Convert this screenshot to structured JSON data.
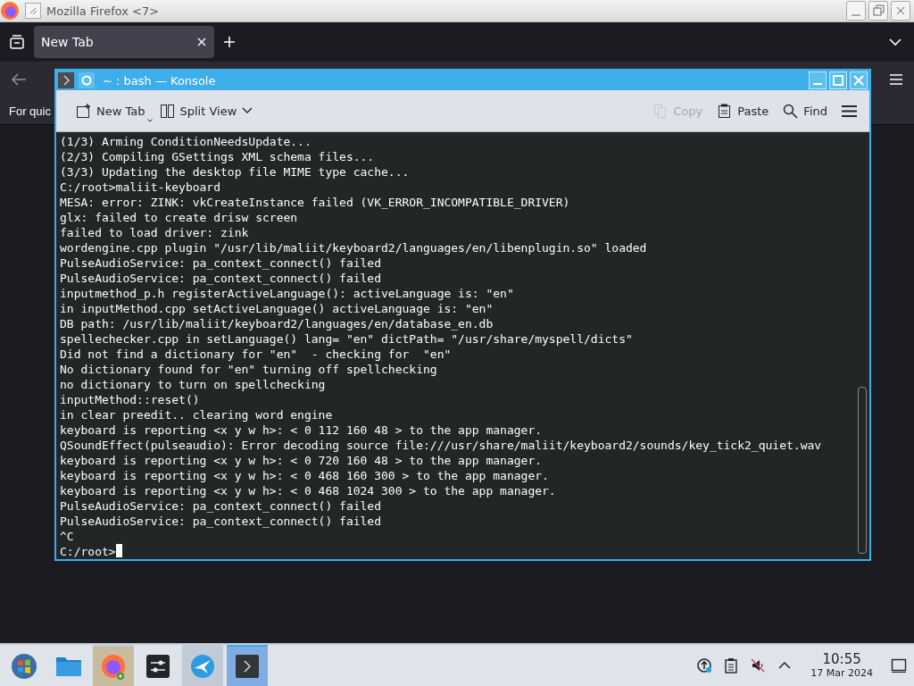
{
  "firefox": {
    "title": "Mozilla Firefox <7>",
    "tabs": [
      {
        "label": "New Tab",
        "selected": true
      }
    ],
    "bookmark_text": "For quic"
  },
  "konsole": {
    "title": "~ : bash — Konsole",
    "toolbar": [
      {
        "kind": "new-tab",
        "label": "New Tab",
        "disabled": false
      },
      {
        "kind": "split-view",
        "label": "Split View",
        "disabled": false
      },
      {
        "kind": "copy",
        "label": "Copy",
        "disabled": true
      },
      {
        "kind": "paste",
        "label": "Paste",
        "disabled": false
      },
      {
        "kind": "find",
        "label": "Find",
        "disabled": false
      },
      {
        "kind": "menu",
        "disabled": false
      }
    ],
    "lines": [
      "(1/3) Arming ConditionNeedsUpdate...",
      "(2/3) Compiling GSettings XML schema files...",
      "(3/3) Updating the desktop file MIME type cache...",
      "C:/root>maliit-keyboard",
      "MESA: error: ZINK: vkCreateInstance failed (VK_ERROR_INCOMPATIBLE_DRIVER)",
      "glx: failed to create drisw screen",
      "failed to load driver: zink",
      "wordengine.cpp plugin \"/usr/lib/maliit/keyboard2/languages/en/libenplugin.so\" loaded",
      "PulseAudioService: pa_context_connect() failed",
      "PulseAudioService: pa_context_connect() failed",
      "inputmethod_p.h registerActiveLanguage(): activeLanguage is: \"en\"",
      "in inputMethod.cpp setActiveLanguage() activeLanguage is: \"en\"",
      "DB path: /usr/lib/maliit/keyboard2/languages/en/database_en.db",
      "spellechecker.cpp in setLanguage() lang= \"en\" dictPath= \"/usr/share/myspell/dicts\"",
      "Did not find a dictionary for \"en\"  - checking for  \"en\"",
      "No dictionary found for \"en\" turning off spellchecking",
      "no dictionary to turn on spellchecking",
      "inputMethod::reset()",
      "in clear preedit.. clearing word engine",
      "keyboard is reporting <x y w h>: < 0 112 160 48 > to the app manager.",
      "QSoundEffect(pulseaudio): Error decoding source file:///usr/share/maliit/keyboard2/sounds/key_tick2_quiet.wav",
      "keyboard is reporting <x y w h>: < 0 720 160 48 > to the app manager.",
      "keyboard is reporting <x y w h>: < 0 468 160 300 > to the app manager.",
      "keyboard is reporting <x y w h>: < 0 468 1024 300 > to the app manager.",
      "PulseAudioService: pa_context_connect() failed",
      "PulseAudioService: pa_context_connect() failed",
      "^C",
      "C:/root>"
    ]
  },
  "taskbar": {
    "apps": [
      {
        "kind": "start",
        "selected": false,
        "attention": false,
        "open": false
      },
      {
        "kind": "files",
        "selected": false,
        "attention": false,
        "open": false
      },
      {
        "kind": "firefox",
        "selected": false,
        "attention": true,
        "open": true
      },
      {
        "kind": "settings",
        "selected": false,
        "attention": false,
        "open": false
      },
      {
        "kind": "bird",
        "selected": false,
        "attention": false,
        "open": true
      },
      {
        "kind": "terminal",
        "selected": true,
        "attention": false,
        "open": true
      }
    ],
    "tray": [
      {
        "kind": "update"
      },
      {
        "kind": "clipboard"
      },
      {
        "kind": "muted"
      },
      {
        "kind": "expand"
      }
    ],
    "time": "10:55",
    "date": "17 Mar 2024"
  }
}
